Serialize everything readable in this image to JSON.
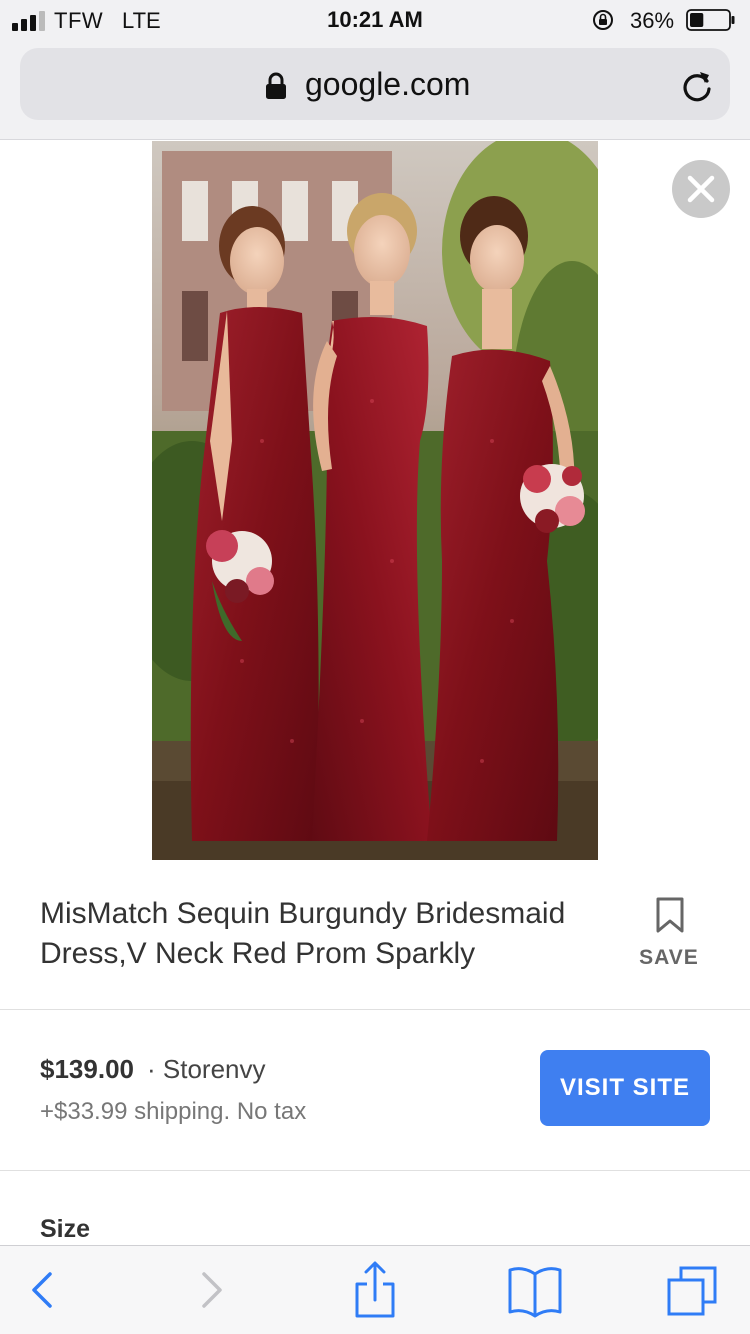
{
  "status_bar": {
    "carrier": "TFW",
    "network": "LTE",
    "time": "10:21 AM",
    "battery_percent": "36%",
    "battery_level": 0.36
  },
  "address_bar": {
    "url": "google.com"
  },
  "product": {
    "title": "MisMatch Sequin Burgundy Bridesmaid Dress,V Neck Red Prom Sparkly",
    "save_label": "SAVE",
    "price": "$139.00",
    "seller": "· Storenvy",
    "shipping": "+$33.99 shipping. No tax",
    "visit_label": "VISIT SITE",
    "size_label": "Size"
  },
  "colors": {
    "accent_blue": "#3f7ff0",
    "ios_blue": "#2f7cf6",
    "dress_burgundy": "#8e1420"
  },
  "icons": {
    "signal": "signal-bars-icon",
    "orientation_lock": "orientation-lock-icon",
    "battery": "battery-icon",
    "lock": "lock-icon",
    "reload": "reload-icon",
    "close": "close-icon",
    "bookmark": "bookmark-icon",
    "back": "chevron-left-icon",
    "forward": "chevron-right-icon",
    "share": "share-icon",
    "bookmarks": "open-book-icon",
    "tabs": "tabs-icon"
  }
}
